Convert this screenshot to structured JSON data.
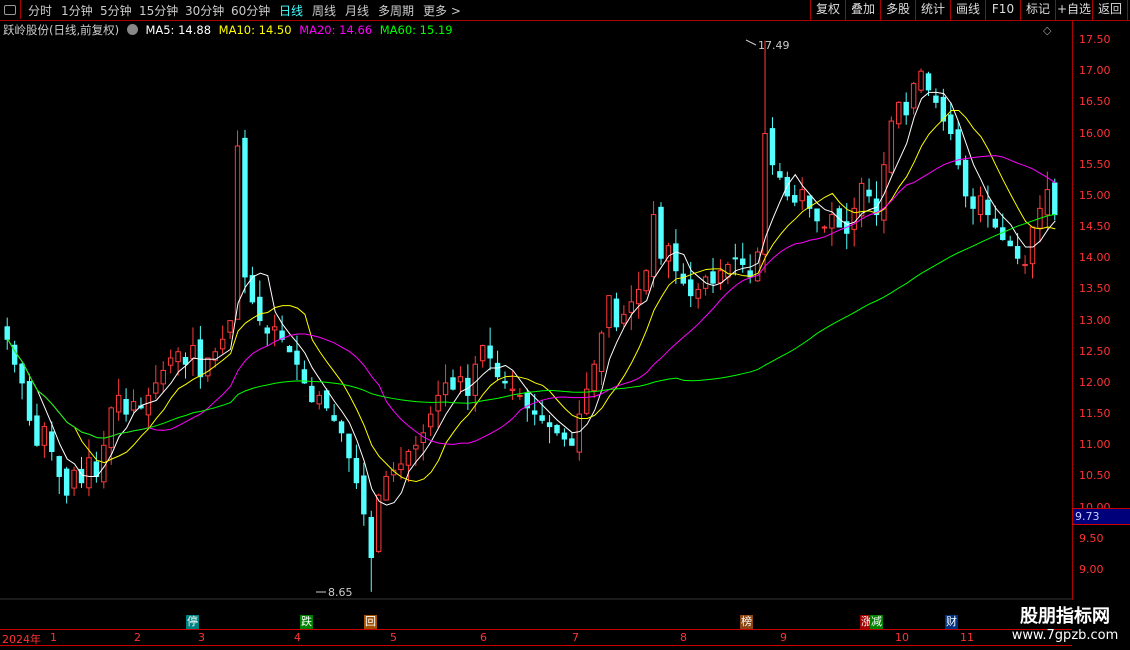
{
  "toolbar": {
    "periods": [
      "分时",
      "1分钟",
      "5分钟",
      "15分钟",
      "30分钟",
      "60分钟",
      "日线",
      "周线",
      "月线",
      "多周期",
      "更多 >"
    ],
    "active": "日线",
    "buttons": [
      "复权",
      "叠加",
      "多股",
      "统计",
      "画线",
      "F10",
      "标记",
      "+自选",
      "返回"
    ]
  },
  "info": {
    "title": "跃岭股份(日线,前复权)",
    "ma5": "MA5: 14.88",
    "ma10": "MA10: 14.50",
    "ma20": "MA20: 14.66",
    "ma60": "MA60: 15.19"
  },
  "colors": {
    "up": "#ff3b3b",
    "down": "#54ffff",
    "ma5": "#ffffff",
    "ma10": "#ffff00",
    "ma20": "#ff00ff",
    "ma60": "#00ff00"
  },
  "chart_data": {
    "type": "candlestick",
    "ylim": [
      8.5,
      17.6
    ],
    "yticks": [
      "17.50",
      "17.00",
      "16.50",
      "16.00",
      "15.50",
      "15.00",
      "14.50",
      "14.00",
      "13.50",
      "13.00",
      "12.50",
      "12.00",
      "11.50",
      "11.00",
      "10.50",
      "10.00",
      "9.50",
      "9.00"
    ],
    "current_price": "9.73",
    "max_label": "17.49",
    "min_label": "8.65",
    "closes": [
      12.7,
      12.3,
      12.0,
      11.4,
      11.0,
      11.3,
      10.9,
      10.5,
      10.2,
      10.6,
      10.4,
      10.8,
      10.5,
      11.0,
      11.6,
      11.8,
      11.5,
      11.7,
      11.6,
      11.8,
      12.0,
      12.2,
      12.4,
      12.5,
      12.3,
      12.6,
      12.1,
      12.4,
      12.5,
      12.7,
      13.0,
      15.8,
      13.7,
      13.3,
      13.0,
      12.8,
      12.9,
      12.7,
      12.5,
      12.3,
      12.0,
      11.7,
      11.8,
      11.6,
      11.4,
      11.2,
      10.8,
      10.4,
      9.9,
      9.2,
      10.2,
      10.5,
      10.6,
      10.7,
      10.9,
      11.0,
      11.2,
      11.5,
      11.8,
      12.0,
      11.9,
      12.1,
      11.8,
      12.3,
      12.6,
      12.4,
      12.1,
      12.0,
      11.9,
      11.8,
      11.6,
      11.5,
      11.4,
      11.3,
      11.2,
      11.1,
      11.0,
      11.5,
      11.9,
      12.3,
      12.8,
      13.4,
      12.9,
      13.1,
      13.3,
      13.5,
      13.8,
      14.7,
      14.0,
      14.2,
      13.8,
      13.6,
      13.4,
      13.5,
      13.7,
      13.6,
      13.8,
      13.9,
      14.0,
      13.9,
      13.7,
      14.1,
      16.0,
      15.5,
      15.3,
      15.0,
      14.9,
      15.1,
      14.8,
      14.6,
      14.5,
      14.7,
      14.5,
      14.4,
      14.8,
      15.2,
      15.0,
      14.7,
      15.5,
      16.2,
      16.5,
      16.3,
      16.8,
      17.0,
      16.7,
      16.5,
      16.2,
      16.0,
      15.5,
      15.0,
      14.8,
      15.0,
      14.7,
      14.5,
      14.3,
      14.2,
      14.0,
      13.9,
      14.5,
      14.8,
      15.1,
      14.7
    ],
    "x_labels": [
      "2024年",
      "1",
      "2",
      "3",
      "4",
      "5",
      "6",
      "7",
      "8",
      "9",
      "10",
      "11"
    ],
    "markers": [
      {
        "text": "停",
        "color": "#008080"
      },
      {
        "text": "跌",
        "color": "#008000"
      },
      {
        "text": "回",
        "color": "#a05000"
      },
      {
        "text": "榜",
        "color": "#8b4513"
      },
      {
        "text": "涨",
        "color": "#a00000"
      },
      {
        "text": "减",
        "color": "#008000"
      },
      {
        "text": "财",
        "color": "#003080"
      }
    ]
  },
  "watermark": {
    "line1": "股朋指标网",
    "line2": "www.7gpzb.com"
  }
}
